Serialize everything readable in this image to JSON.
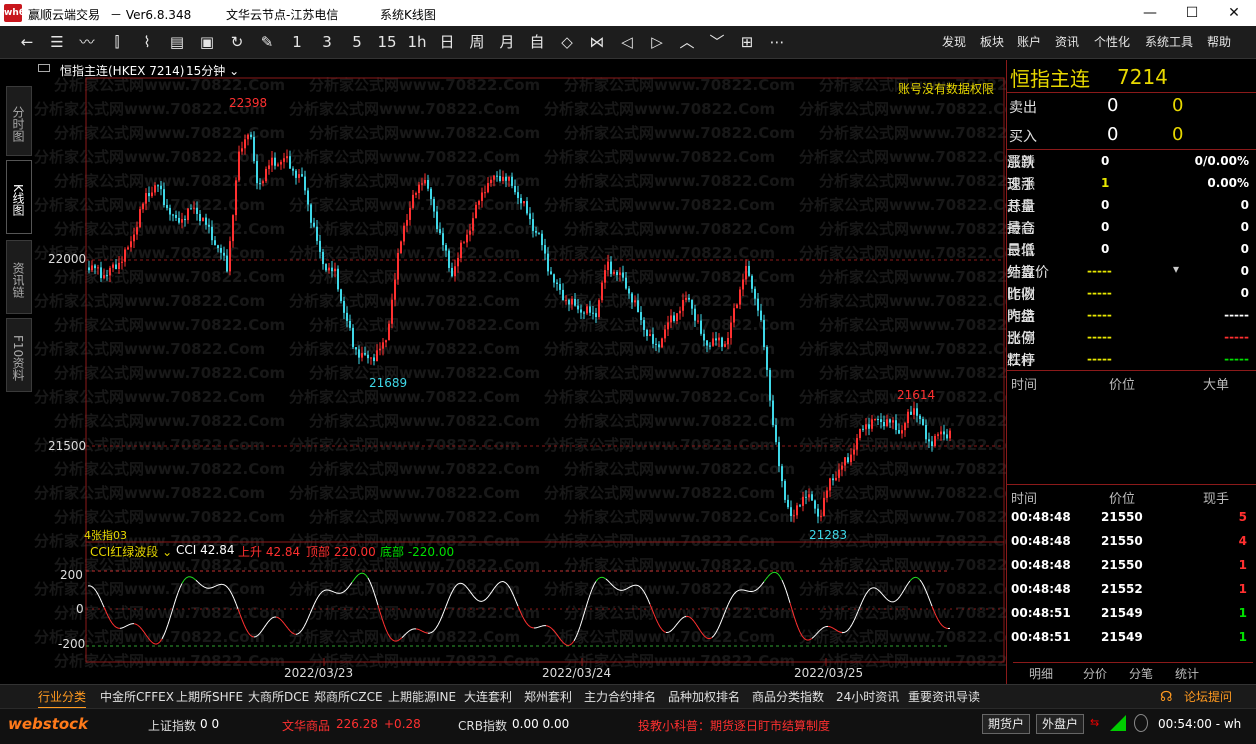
{
  "titlebar": {
    "logo": "wh6",
    "app": "赢顺云端交易",
    "version": "－ Ver6.8.348",
    "node": "文华云节点-江苏电信",
    "view": "系统K线图"
  },
  "toolbar": {
    "menus": [
      "发现",
      "板块",
      "账户",
      "资讯",
      "个性化",
      "系统工具",
      "帮助"
    ],
    "periods": [
      "1",
      "3",
      "5",
      "15",
      "1h",
      "日",
      "周",
      "月",
      "自"
    ]
  },
  "lefttabs": [
    "分时图",
    "K线图",
    "资讯链",
    "F10资料"
  ],
  "chart": {
    "symbol": "恒指主连(HKEX 7214)",
    "period": "15分钟",
    "no_permission": "账号没有数据权限",
    "high_label": "22398",
    "low_label": "21689",
    "high2_label": "21614",
    "low2_label": "21283",
    "y_labels": [
      "22000",
      "21500"
    ],
    "x_labels": [
      "2022/03/23",
      "2022/03/24",
      "2022/03/25"
    ],
    "indicator_tab": "4张指03",
    "indicator": {
      "name": "CCI红绿波段",
      "value": "CCI 42.84",
      "rise": "上升 42.84",
      "top": "顶部 220.00",
      "bottom": "底部 -220.00"
    },
    "cci_y": [
      "200",
      "0",
      "-200"
    ],
    "watermark": "分析家公式网www.70822.Com"
  },
  "quote": {
    "title": "恒指主连",
    "code": "7214",
    "sell_label": "卖出",
    "sell_price": "0",
    "sell_vol": "0",
    "buy_label": "买入",
    "buy_price": "0",
    "buy_vol": "0",
    "rows": [
      {
        "l1": "最新",
        "v1": "0",
        "l2": "涨跌",
        "v2": "0/0.00%"
      },
      {
        "l1": "现手",
        "v1": "1",
        "l2": "速涨",
        "v2": "0.00%"
      },
      {
        "l1": "总量",
        "v1": "0",
        "l2": "开盘",
        "v2": "0"
      },
      {
        "l1": "持仓",
        "v1": "0",
        "l2": "最高",
        "v2": "0"
      },
      {
        "l1": "日增",
        "v1": "0",
        "l2": "最低",
        "v2": "0"
      },
      {
        "l1": "外盘",
        "v1": "-----",
        "l2": "结算价",
        "v2": "0"
      },
      {
        "l1": "比例",
        "v1": "-----",
        "l2": "昨收",
        "v2": "0"
      },
      {
        "l1": "内盘",
        "v1": "-----",
        "l2": "昨结",
        "v2": "-----"
      },
      {
        "l1": "比例",
        "v1": "-----",
        "l2": "涨停",
        "v2": "-----"
      },
      {
        "l1": "杠杆",
        "v1": "-----",
        "l2": "跌停",
        "v2": "-----"
      }
    ],
    "bigorder_headers": [
      "时间",
      "价位",
      "大单"
    ],
    "ticks_headers": [
      "时间",
      "价位",
      "现手"
    ],
    "ticks": [
      {
        "time": "00:48:48",
        "price": "21550",
        "vol": "5",
        "color": "red"
      },
      {
        "time": "00:48:48",
        "price": "21550",
        "vol": "4",
        "color": "red"
      },
      {
        "time": "00:48:48",
        "price": "21550",
        "vol": "1",
        "color": "red"
      },
      {
        "time": "00:48:48",
        "price": "21552",
        "vol": "1",
        "color": "red"
      },
      {
        "time": "00:48:51",
        "price": "21549",
        "vol": "1",
        "color": "grn"
      },
      {
        "time": "00:48:51",
        "price": "21549",
        "vol": "1",
        "color": "grn"
      }
    ],
    "bottom_tabs": [
      "明细",
      "分价",
      "分笔",
      "统计"
    ]
  },
  "bottombar": {
    "tabs": [
      "行业分类",
      "中金所CFFEX",
      "上期所SHFE",
      "大商所DCE",
      "郑商所CZCE",
      "上期能源INE",
      "大连套利",
      "郑州套利",
      "主力合约排名",
      "品种加权排名",
      "商品分类指数",
      "24小时资讯",
      "重要资讯导读"
    ],
    "forum": "论坛提问"
  },
  "statusbar": {
    "brand": "webstock",
    "idx1_name": "上证指数",
    "idx1_val": "0 0",
    "idx2_name": "文华商品",
    "idx2_val": "226.28",
    "idx2_chg": "+0.28",
    "idx3_name": "CRB指数",
    "idx3_val": "0.00 0.00",
    "ticker": "投教小科普：期货逐日盯市结算制度",
    "btn1": "期货户",
    "btn2": "外盘户",
    "clock": "00:54:00 - wh"
  },
  "colors": {
    "up": "#ff3030",
    "down": "#3fd8e8",
    "grid": "#8b1a1a"
  }
}
